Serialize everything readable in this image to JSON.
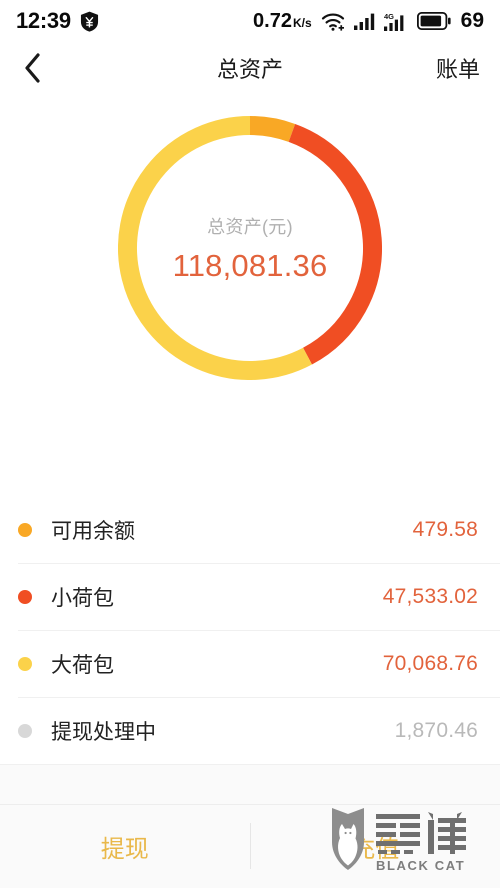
{
  "status_bar": {
    "time": "12:39",
    "shield_icon": "shield-yuan-icon",
    "network_speed": "0.72",
    "network_speed_unit": "K/s",
    "wifi_icon": "wifi-icon",
    "signal_icon": "signal-bars-icon",
    "signal_4g_icon": "signal-4g-bars-icon",
    "battery_icon": "battery-icon",
    "battery_level": "69"
  },
  "nav_bar": {
    "back_icon": "chevron-left-icon",
    "title": "总资产",
    "right_action": "账单"
  },
  "summary": {
    "center_label": "总资产(元)",
    "center_value": "118,081.36"
  },
  "colors": {
    "available": "#F9A825",
    "small_pocket": "#F04E23",
    "big_pocket": "#FBD24A",
    "processing": "#D8D8D8",
    "value_text": "#E2633C",
    "muted_text": "#B9B9B9",
    "action_text": "#E9B84A"
  },
  "legend": {
    "rows": [
      {
        "label": "可用余额",
        "value": "479.58",
        "color": "#F9A825",
        "muted": false
      },
      {
        "label": "小荷包",
        "value": "47,533.02",
        "color": "#F04E23",
        "muted": false
      },
      {
        "label": "大荷包",
        "value": "70,068.76",
        "color": "#FBD24A",
        "muted": false
      },
      {
        "label": "提现处理中",
        "value": "1,870.46",
        "color": "#D8D8D8",
        "muted": true
      }
    ]
  },
  "bottom_bar": {
    "withdraw_label": "提现",
    "recharge_label": "充值"
  },
  "watermark": {
    "brand_cn": "黑猫",
    "brand_en": "BLACK CAT",
    "shield_icon": "black-cat-shield-icon"
  },
  "chart_data": {
    "type": "pie",
    "title": "总资产(元)",
    "center_total": 118081.36,
    "donut": true,
    "inner_radius_px": 113,
    "outer_radius_px": 132,
    "start_angle_deg": 0,
    "legend_position": "below",
    "categories": [
      "可用余额",
      "小荷包",
      "大荷包"
    ],
    "values": [
      479.58,
      47533.02,
      70068.76
    ],
    "colors": [
      "#F9A825",
      "#F04E23",
      "#FBD24A"
    ],
    "drawn_sweep_deg": [
      20,
      132,
      208
    ],
    "excluded_from_donut": [
      {
        "label": "提现处理中",
        "value": 1870.46,
        "color": "#D8D8D8"
      }
    ]
  }
}
